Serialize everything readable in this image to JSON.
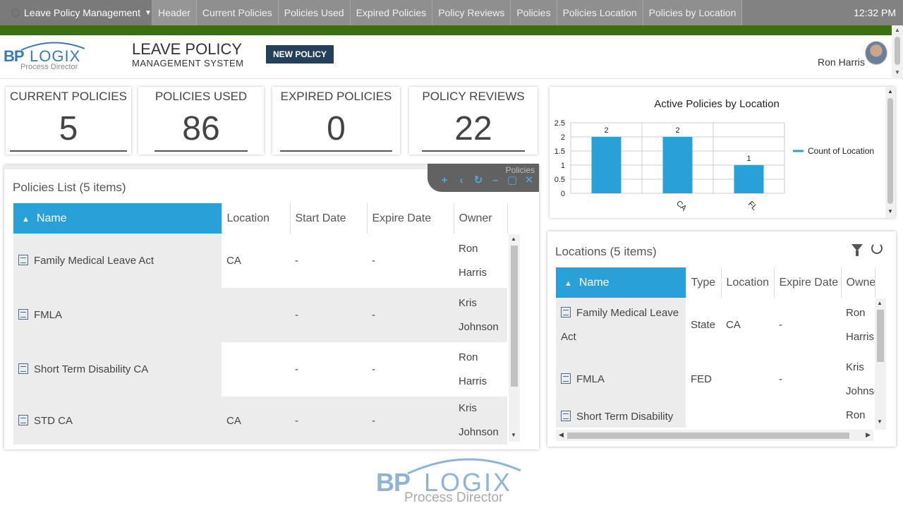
{
  "nav": {
    "app_menu": "Leave Policy Management",
    "tabs": [
      "Header",
      "Current Policies",
      "Policies Used",
      "Expired Policies",
      "Policy Reviews",
      "Policies",
      "Policies Location",
      "Policies by Location"
    ],
    "time": "12:32 PM"
  },
  "logo": {
    "bp": "BP",
    "logix": "LOGIX",
    "product": "Process Director"
  },
  "header": {
    "title": "LEAVE POLICY",
    "subtitle": "MANAGEMENT SYSTEM",
    "new_policy": "NEW POLICY",
    "user": "Ron Harris"
  },
  "kpis": [
    {
      "label": "CURRENT POLICIES",
      "value": "5"
    },
    {
      "label": "POLICIES USED",
      "value": "86"
    },
    {
      "label": "EXPIRED POLICIES",
      "value": "0"
    },
    {
      "label": "POLICY REVIEWS",
      "value": "22"
    }
  ],
  "chart_data": {
    "type": "bar",
    "title": "Active Policies by Location",
    "categories": [
      "",
      "CA",
      "FL"
    ],
    "series": [
      {
        "name": "Count of Location",
        "values": [
          2,
          2,
          1
        ],
        "color": "#2aa0d9"
      }
    ],
    "ylim": [
      0,
      2.5
    ],
    "yticks": [
      "2.5",
      "2",
      "1.5",
      "1",
      "0.5",
      "0"
    ],
    "data_labels": [
      "2",
      "2",
      "1"
    ],
    "grid": true,
    "legend": "right"
  },
  "policies": {
    "title": "Policies List (5 items)",
    "toolbar_label": "Policies",
    "columns": [
      "Name",
      "Location",
      "Start Date",
      "Expire Date",
      "Owner"
    ],
    "rows": [
      {
        "name": "Family Medical Leave Act",
        "location": "CA",
        "start": "-",
        "expire": "-",
        "owner1": "Ron",
        "owner2": "Harris"
      },
      {
        "name": "FMLA",
        "location": "",
        "start": "-",
        "expire": "-",
        "owner1": "Kris",
        "owner2": "Johnson"
      },
      {
        "name": "Short Term Disability CA",
        "location": "",
        "start": "-",
        "expire": "-",
        "owner1": "Ron",
        "owner2": "Harris"
      },
      {
        "name": "STD CA",
        "location": "CA",
        "start": "-",
        "expire": "-",
        "owner1": "Kris",
        "owner2": "Johnson"
      }
    ]
  },
  "locations": {
    "title": "Locations (5 items)",
    "columns": [
      "Name",
      "Type",
      "Location",
      "Expire Date",
      "Owne"
    ],
    "rows": [
      {
        "name1": "Family Medical Leave",
        "name2": "Act",
        "type": "State",
        "location": "CA",
        "expire": "-",
        "owner1": "Ron",
        "owner2": "Harris"
      },
      {
        "name1": "FMLA",
        "name2": "",
        "type": "FED",
        "location": "",
        "expire": "-",
        "owner1": "Kris",
        "owner2": "Johnsc"
      },
      {
        "name1": "Short Term Disability",
        "name2": "",
        "type": "",
        "location": "",
        "expire": "",
        "owner1": "Ron",
        "owner2": ""
      }
    ]
  }
}
